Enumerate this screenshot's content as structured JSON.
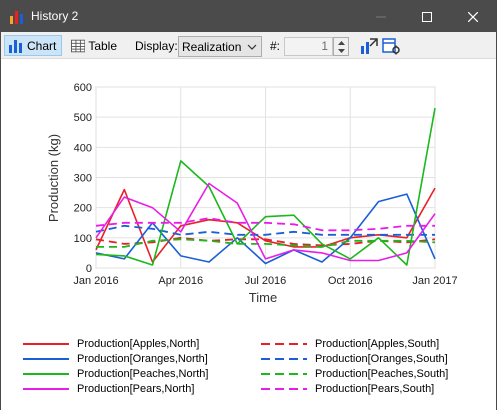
{
  "window": {
    "title": "History 2",
    "icon": "bar-chart-icon"
  },
  "toolbar": {
    "chart_label": "Chart",
    "table_label": "Table",
    "display_label": "Display:",
    "display_value": "Realization",
    "number_label": "#:",
    "number_value": "1",
    "icons": [
      "chart-icon",
      "table-icon",
      "chevron-down-icon",
      "spin-up-icon",
      "spin-down-icon",
      "export-icon",
      "settings-icon"
    ]
  },
  "chart_data": {
    "type": "line",
    "title": "",
    "xlabel": "Time",
    "ylabel": "Production (kg)",
    "ylim": [
      0,
      600
    ],
    "yticks": [
      "0",
      "100",
      "200",
      "300",
      "400",
      "500",
      "600"
    ],
    "xticks": [
      "Jan 2016",
      "Apr 2016",
      "Jul 2016",
      "Oct 2016",
      "Jan 2017"
    ],
    "x": [
      "Jan 2016",
      "Feb 2016",
      "Mar 2016",
      "Apr 2016",
      "May 2016",
      "Jun 2016",
      "Jul 2016",
      "Aug 2016",
      "Sep 2016",
      "Oct 2016",
      "Nov 2016",
      "Dec 2016",
      "Jan 2017"
    ],
    "grid": true,
    "legend_position": "bottom",
    "series": [
      {
        "name": "Production[Apples,North]",
        "color": "#e8202a",
        "dash": false,
        "values": [
          60,
          260,
          20,
          140,
          160,
          150,
          90,
          70,
          70,
          100,
          110,
          100,
          265
        ]
      },
      {
        "name": "Production[Apples,South]",
        "color": "#e8202a",
        "dash": true,
        "values": [
          95,
          80,
          85,
          100,
          90,
          95,
          95,
          80,
          75,
          80,
          90,
          85,
          95
        ]
      },
      {
        "name": "Production[Oranges,North]",
        "color": "#1a5fd6",
        "dash": false,
        "values": [
          50,
          30,
          150,
          40,
          20,
          100,
          15,
          60,
          20,
          100,
          220,
          245,
          30
        ]
      },
      {
        "name": "Production[Oranges,South]",
        "color": "#1a5fd6",
        "dash": true,
        "values": [
          120,
          140,
          130,
          110,
          120,
          110,
          110,
          120,
          110,
          110,
          110,
          110,
          110
        ]
      },
      {
        "name": "Production[Peaches,North]",
        "color": "#1cb81c",
        "dash": false,
        "values": [
          45,
          40,
          10,
          355,
          270,
          80,
          170,
          175,
          80,
          30,
          100,
          10,
          530
        ]
      },
      {
        "name": "Production[Peaches,South]",
        "color": "#1cb81c",
        "dash": true,
        "values": [
          70,
          70,
          90,
          95,
          90,
          80,
          80,
          75,
          70,
          90,
          90,
          90,
          85
        ]
      },
      {
        "name": "Production[Pears,North]",
        "color": "#e81ee8",
        "dash": false,
        "values": [
          100,
          235,
          200,
          120,
          280,
          215,
          30,
          60,
          50,
          25,
          25,
          50,
          180
        ]
      },
      {
        "name": "Production[Pears,South]",
        "color": "#e81ee8",
        "dash": true,
        "values": [
          140,
          150,
          150,
          150,
          165,
          150,
          150,
          145,
          125,
          125,
          130,
          140,
          140
        ]
      }
    ]
  }
}
